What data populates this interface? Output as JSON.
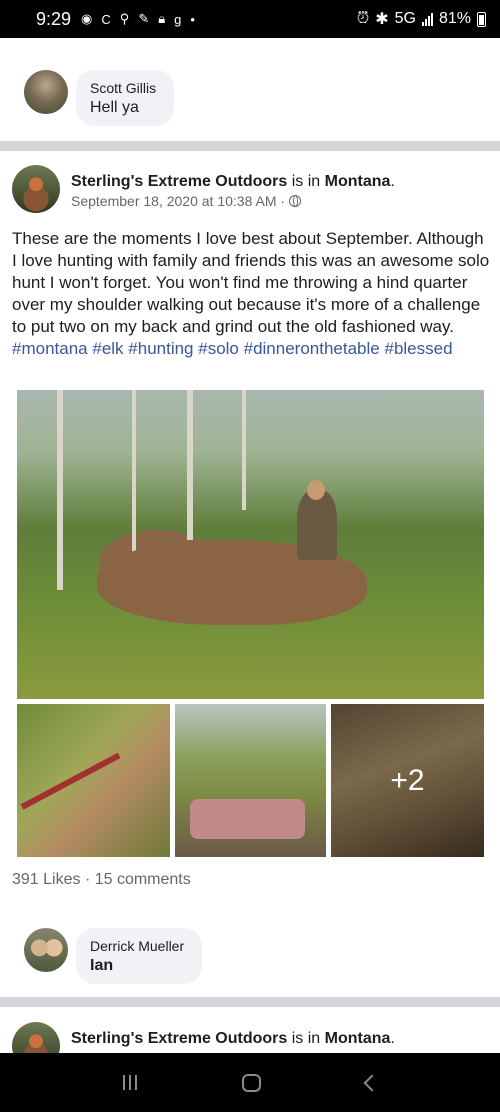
{
  "status_bar": {
    "time": "9:29",
    "left_icons": [
      "sync-icon",
      "c-icon",
      "shield-icon",
      "feather-icon",
      "lock-icon",
      "g-icon",
      "dot-icon"
    ],
    "network": "5G",
    "battery": "81%"
  },
  "comments": [
    {
      "name": "Scott Gillis",
      "text": "Hell ya"
    },
    {
      "name": "Derrick Mueller",
      "text": "Ian"
    }
  ],
  "post": {
    "page_name": "Sterling's Extreme Outdoors",
    "connector": " is in ",
    "location": "Montana",
    "period": ".",
    "date": "September 18, 2020 at 10:38 AM · ",
    "body": "These are the moments I love best about September. Although I love hunting with family and friends this was an awesome solo hunt I won't forget. You won't find me throwing a hind quarter over my shoulder walking out because it's more of a challenge to put two on my back and grind out the old fashioned way.",
    "hashtags": [
      "#montana",
      "#elk",
      "#hunting",
      "#solo",
      "#dinneronthetable",
      "#blessed"
    ],
    "more_photos": "+2",
    "reactions": "391 Likes · 15 comments"
  },
  "next_post": {
    "page_name": "Sterling's Extreme Outdoors",
    "connector": " is in ",
    "location": "Montana",
    "period": "."
  },
  "nav": [
    "recents-icon",
    "home-icon",
    "back-icon"
  ]
}
